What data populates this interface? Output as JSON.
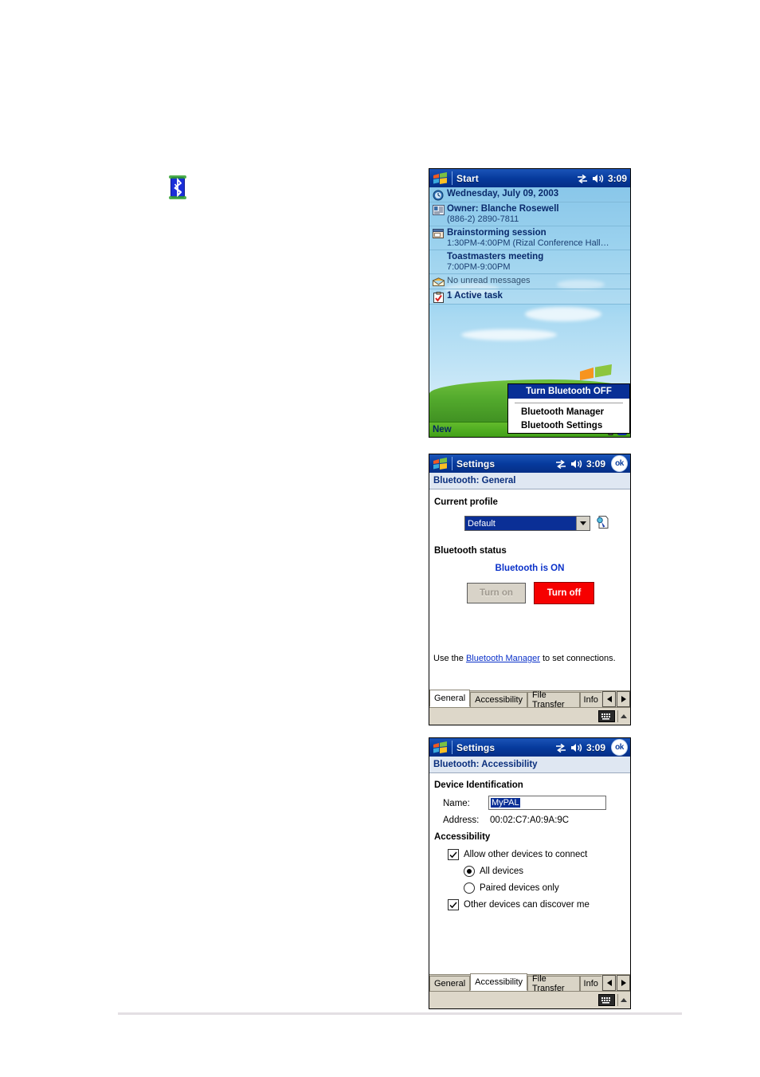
{
  "today_screen": {
    "titlebar": {
      "title": "Start",
      "time": "3:09",
      "icons": [
        "start-flag-icon",
        "connectivity-icon",
        "speaker-icon"
      ]
    },
    "rows": [
      {
        "icon": "clock-icon",
        "line1": "Wednesday, July 09, 2003",
        "line2": ""
      },
      {
        "icon": "contact-card-icon",
        "line1": "Owner: Blanche Rosewell",
        "line2": "(886-2) 2890-7811"
      },
      {
        "icon": "calendar-icon",
        "line1": "Brainstorming session",
        "line2": "1:30PM-4:00PM (Rizal Conference Hall…"
      },
      {
        "icon": "calendar-icon",
        "line1": "Toastmasters meeting",
        "line2": "7:00PM-9:00PM"
      },
      {
        "icon": "envelope-icon",
        "line1": "",
        "line2": "",
        "dim": "No unread messages"
      },
      {
        "icon": "task-clipboard-icon",
        "line1": "1 Active task",
        "line2": ""
      }
    ],
    "context_menu": {
      "highlighted": "Turn Bluetooth OFF",
      "items": [
        "Bluetooth Manager",
        "Bluetooth Settings"
      ]
    },
    "taskbar": {
      "new_label": "New",
      "tray_icons": [
        "connection-icon",
        "bluetooth-tray-icon"
      ]
    }
  },
  "general_screen": {
    "titlebar": {
      "title": "Settings",
      "time": "3:09",
      "ok_label": "ok"
    },
    "subtitle": "Bluetooth: General",
    "profile_section": {
      "header": "Current profile",
      "selected": "Default",
      "options": [
        "Default"
      ],
      "edit_icon": "profile-edit-icon"
    },
    "status_section": {
      "header": "Bluetooth status",
      "status_text": "Bluetooth is ON",
      "status_color": "#0a31c9",
      "turn_on_label": "Turn on",
      "turn_off_label": "Turn off",
      "turn_off_color": "#f60000"
    },
    "hint": {
      "before": "Use the ",
      "link": "Bluetooth Manager",
      "after": " to set connections."
    },
    "tabs": [
      {
        "label": "General",
        "active": true
      },
      {
        "label": "Accessibility",
        "active": false
      },
      {
        "label": "File Transfer",
        "active": false
      },
      {
        "label": "Info",
        "active": false,
        "clipped": true
      }
    ],
    "tab_scroll": {
      "left": "◀",
      "right": "▶"
    },
    "sip": {
      "keyboard_icon": "keyboard-icon",
      "up_arrow": "sip-up-arrow"
    }
  },
  "accessibility_screen": {
    "titlebar": {
      "title": "Settings",
      "time": "3:09",
      "ok_label": "ok"
    },
    "subtitle": "Bluetooth: Accessibility",
    "device_identification": {
      "header": "Device Identification",
      "name_label": "Name:",
      "name_value": "MyPAL",
      "address_label": "Address:",
      "address_value": "00:02:C7:A0:9A:9C"
    },
    "accessibility": {
      "header": "Accessibility",
      "allow_connect": {
        "label": "Allow other devices to connect",
        "checked": true
      },
      "radios": [
        {
          "label": "All devices",
          "selected": true
        },
        {
          "label": "Paired devices only",
          "selected": false
        }
      ],
      "discoverable": {
        "label": "Other devices can discover me",
        "checked": true
      }
    },
    "tabs": [
      {
        "label": "General",
        "active": false
      },
      {
        "label": "Accessibility",
        "active": true
      },
      {
        "label": "File Transfer",
        "active": false
      },
      {
        "label": "Info",
        "active": false,
        "clipped": true
      }
    ],
    "tab_scroll": {
      "left": "◀",
      "right": "▶"
    },
    "sip": {
      "keyboard_icon": "keyboard-icon",
      "up_arrow": "sip-up-arrow"
    }
  }
}
